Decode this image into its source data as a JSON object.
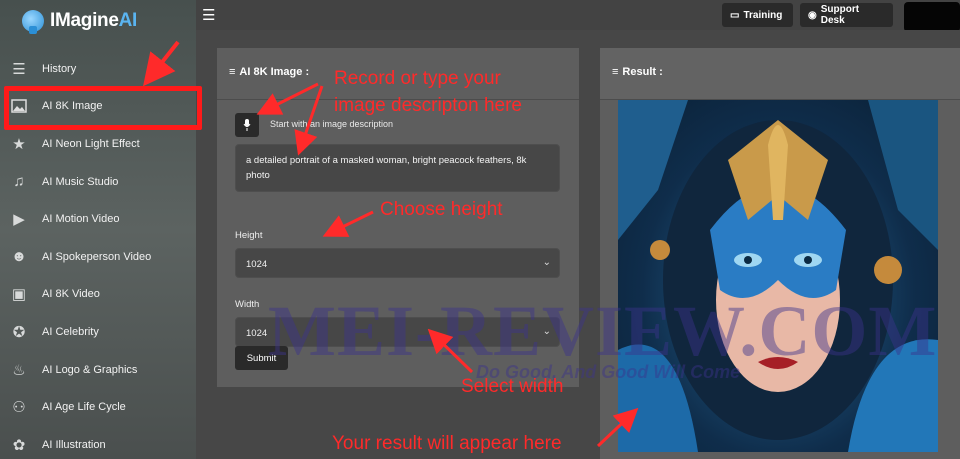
{
  "app": {
    "logo_text": "IMagine",
    "logo_ai": "AI"
  },
  "sidebar": {
    "items": [
      {
        "label": "History",
        "icon": "list-icon"
      },
      {
        "label": "AI 8K Image",
        "icon": "image-icon"
      },
      {
        "label": "AI Neon Light Effect",
        "icon": "star-icon"
      },
      {
        "label": "AI Music Studio",
        "icon": "music-icon"
      },
      {
        "label": "AI Motion Video",
        "icon": "play-icon"
      },
      {
        "label": "AI Spokeperson Video",
        "icon": "person-icon"
      },
      {
        "label": "AI 8K Video",
        "icon": "video-icon"
      },
      {
        "label": "AI Celebrity",
        "icon": "celebrity-star-icon"
      },
      {
        "label": "AI Logo & Graphics",
        "icon": "fire-icon"
      },
      {
        "label": "AI Age Life Cycle",
        "icon": "people-icon"
      },
      {
        "label": "AI Illustration",
        "icon": "palette-icon"
      }
    ]
  },
  "topbar": {
    "training_label": "Training",
    "support_label": "Support Desk"
  },
  "form": {
    "header": "AI 8K Image :",
    "mic_label": "Start with an image description",
    "description_value": "a detailed portrait of a masked woman, bright peacock feathers, 8k photo",
    "height_label": "Height",
    "height_value": "1024",
    "width_label": "Width",
    "width_value": "1024",
    "submit_label": "Submit"
  },
  "result": {
    "header": "Result :"
  },
  "watermark": {
    "main": "MEI-REVIEW.COM",
    "tagline": "Do Good, And Good Will Come"
  },
  "annotations": {
    "record": "Record or type your",
    "record2": "image descripton here",
    "height": "Choose height",
    "width": "Select width",
    "result": "Your result will appear here"
  },
  "colors": {
    "annotation": "#ff2a2a",
    "accent": "#5ab4f0"
  }
}
